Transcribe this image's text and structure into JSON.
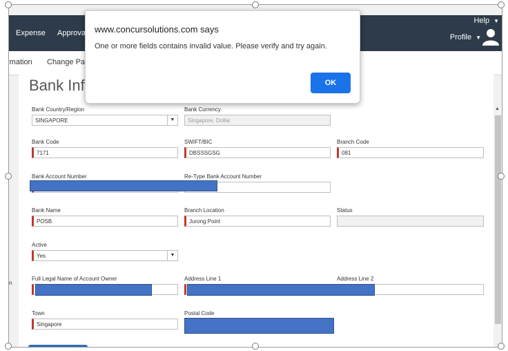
{
  "topbar": {
    "expense": "Expense",
    "approvals": "Approvals",
    "help": "Help",
    "profile": "Profile"
  },
  "subnav": {
    "information": "rmation",
    "change_password": "Change Pass"
  },
  "page": {
    "title": "Bank Info"
  },
  "fields": {
    "bank_country": {
      "label": "Bank Country/Region",
      "value": "SINGAPORE"
    },
    "bank_currency": {
      "label": "Bank Currency",
      "value": "Singapore, Dollar"
    },
    "bank_code": {
      "label": "Bank Code",
      "value": "7171"
    },
    "swift": {
      "label": "SWIFT/BIC",
      "value": "DBSSSGSG"
    },
    "branch_code": {
      "label": "Branch Code",
      "value": "081"
    },
    "account_number": {
      "label": "Bank Account Number"
    },
    "retype_account": {
      "label": "Re-Type Bank Account Number"
    },
    "bank_name": {
      "label": "Bank Name",
      "value": "POSB"
    },
    "branch_location": {
      "label": "Branch Location",
      "value": "Jurong Point"
    },
    "status": {
      "label": "Status",
      "value": ""
    },
    "active": {
      "label": "Active",
      "value": "Yes"
    },
    "legal_name": {
      "label": "Full Legal Name of Account Owner"
    },
    "address1": {
      "label": "Address Line 1"
    },
    "address2": {
      "label": "Address Line 2"
    },
    "town": {
      "label": "Town",
      "value": "Singapore"
    },
    "postal_code": {
      "label": "Postal Code"
    }
  },
  "left_edge_text": "n",
  "dialog": {
    "title": "www.concursolutions.com says",
    "message": "One or more fields contains invalid value. Please verify and try again.",
    "ok_label": "OK"
  },
  "colors": {
    "topbar": "#2d3b4a",
    "ok_button": "#1a73e8",
    "redaction": "#4472c4",
    "required": "#c0392b"
  }
}
